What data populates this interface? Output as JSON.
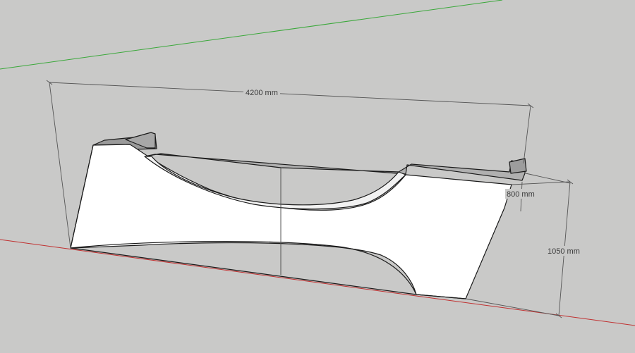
{
  "dimensions": {
    "length_label": "4200 mm",
    "height_back_label": "800 mm",
    "height_total_label": "1050 mm"
  },
  "colors": {
    "background": "#c9c9c8",
    "face_front": "#ffffff",
    "face_top": "#9a9a9a",
    "face_side": "#e6e6e6",
    "edge": "#1a1a1a",
    "axis_green": "#3aa83a",
    "axis_red": "#c03030",
    "dimension_line": "#555555"
  }
}
